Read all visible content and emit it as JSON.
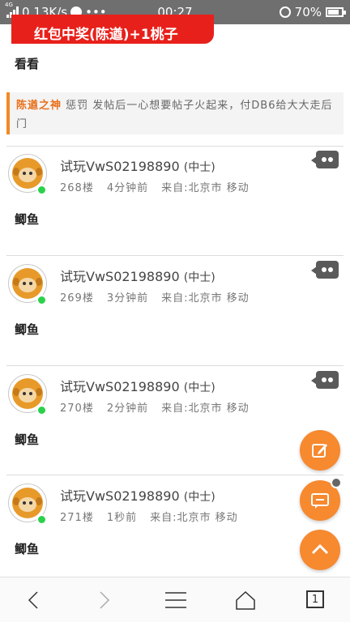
{
  "status_bar": {
    "network_tag": "4G",
    "speed": "0.13K/s",
    "more": "•••",
    "time": "00:27",
    "battery": "70%",
    "battery_level": 0.7
  },
  "banner": {
    "text": "红包中奖(陈遒)+1桃子"
  },
  "look_text": "看看",
  "notice": {
    "name": "陈遒之神",
    "text": " 惩罚 发帖后一心想要帖子火起来，付DB6给大大走后门"
  },
  "posts": [
    {
      "username": "试玩VwS02198890",
      "rank": "(中士)",
      "floor": "268楼",
      "time": "4分钟前",
      "source": "来自:北京市 移动",
      "content": "鲫鱼"
    },
    {
      "username": "试玩VwS02198890",
      "rank": "(中士)",
      "floor": "269楼",
      "time": "3分钟前",
      "source": "来自:北京市 移动",
      "content": "鲫鱼"
    },
    {
      "username": "试玩VwS02198890",
      "rank": "(中士)",
      "floor": "270楼",
      "time": "2分钟前",
      "source": "来自:北京市 移动",
      "content": "鲫鱼"
    },
    {
      "username": "试玩VwS02198890",
      "rank": "(中士)",
      "floor": "271楼",
      "time": "1秒前",
      "source": "来自:北京市 移动",
      "content": "鲫鱼"
    }
  ],
  "fabs": [
    "edit-icon",
    "comment-icon",
    "chevron-up-icon"
  ],
  "navbar": {
    "tab_count": "1"
  },
  "colors": {
    "accent": "#f7892f",
    "banner": "#e8201b",
    "online": "#2bd14a",
    "notice_name": "#e8701b"
  }
}
